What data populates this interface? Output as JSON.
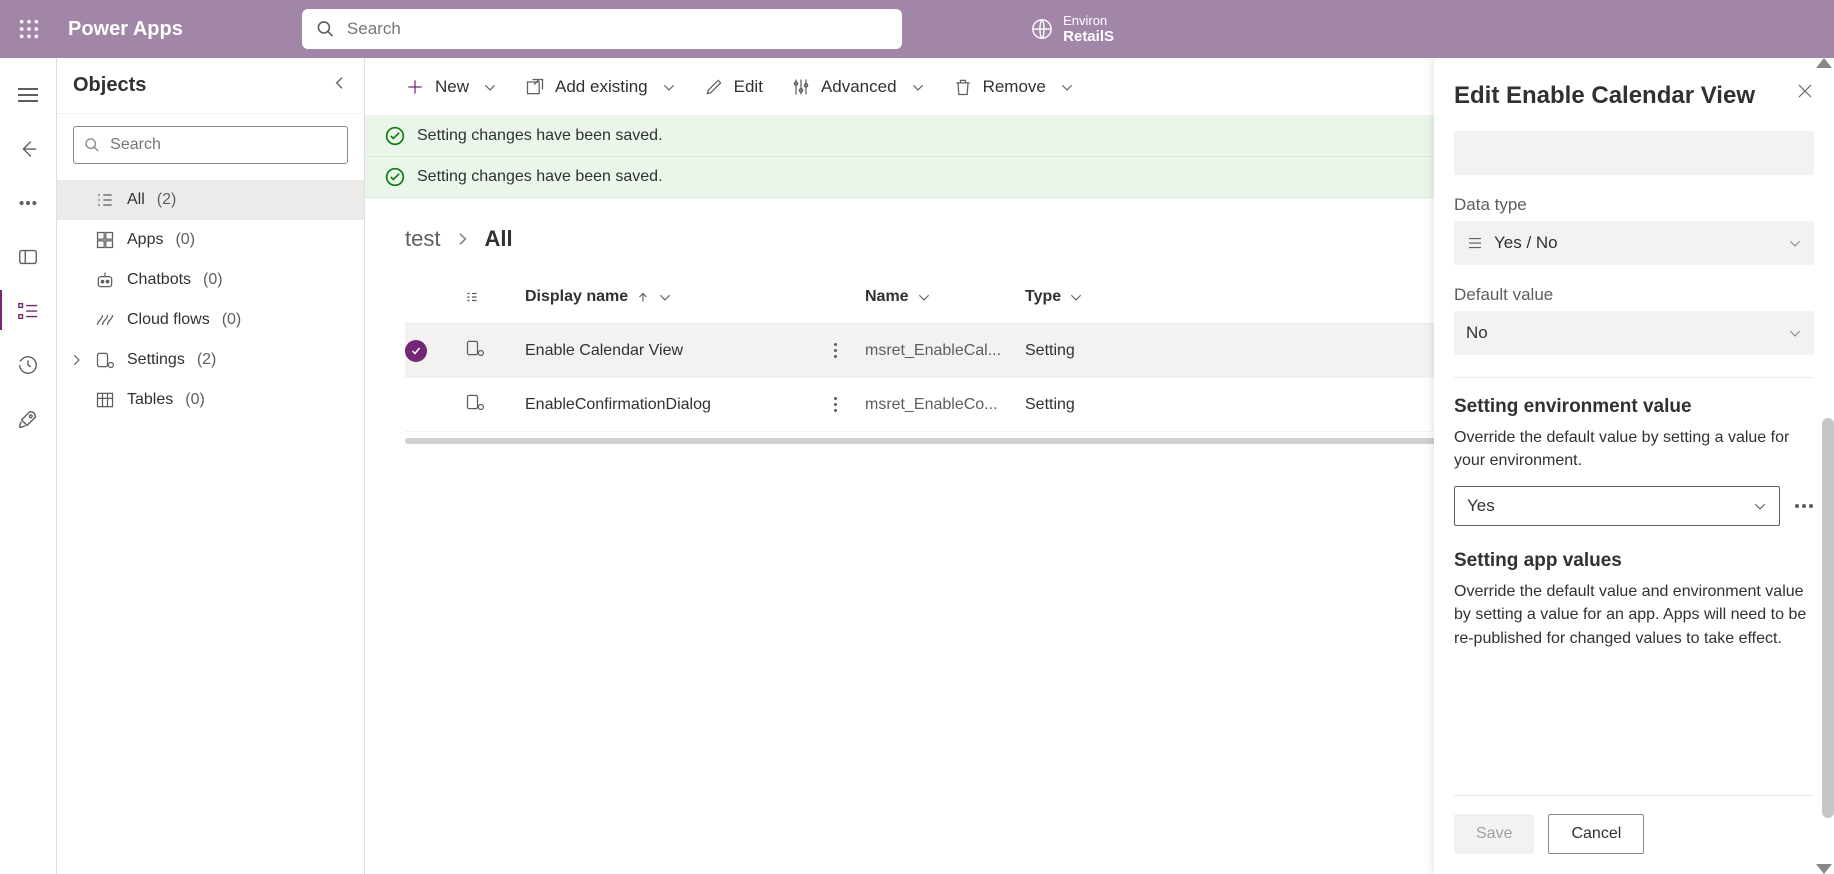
{
  "header": {
    "app_title": "Power Apps",
    "search_placeholder": "Search",
    "environment_label": "Environ",
    "environment_name": "RetailS"
  },
  "sidebar": {
    "title": "Objects",
    "search_placeholder": "Search",
    "items": [
      {
        "label": "All",
        "count": "(2)"
      },
      {
        "label": "Apps",
        "count": "(0)"
      },
      {
        "label": "Chatbots",
        "count": "(0)"
      },
      {
        "label": "Cloud flows",
        "count": "(0)"
      },
      {
        "label": "Settings",
        "count": "(2)"
      },
      {
        "label": "Tables",
        "count": "(0)"
      }
    ]
  },
  "commands": {
    "new": "New",
    "add_existing": "Add existing",
    "edit": "Edit",
    "advanced": "Advanced",
    "remove": "Remove"
  },
  "toasts": [
    "Setting changes have been saved.",
    "Setting changes have been saved."
  ],
  "breadcrumb": {
    "root": "test",
    "current": "All"
  },
  "table": {
    "columns": {
      "display_name": "Display name",
      "name": "Name",
      "type": "Type"
    },
    "rows": [
      {
        "display_name": "Enable Calendar View",
        "name": "msret_EnableCal...",
        "type": "Setting",
        "selected": true
      },
      {
        "display_name": "EnableConfirmationDialog",
        "name": "msret_EnableCo...",
        "type": "Setting",
        "selected": false
      }
    ]
  },
  "panel": {
    "title": "Edit Enable Calendar View",
    "data_type_label": "Data type",
    "data_type_value": "Yes / No",
    "default_value_label": "Default value",
    "default_value": "No",
    "env_heading": "Setting environment value",
    "env_desc": "Override the default value by setting a value for your environment.",
    "env_value": "Yes",
    "app_heading": "Setting app values",
    "app_desc": "Override the default value and environment value by setting a value for an app. Apps will need to be re-published for changed values to take effect.",
    "save": "Save",
    "cancel": "Cancel"
  }
}
